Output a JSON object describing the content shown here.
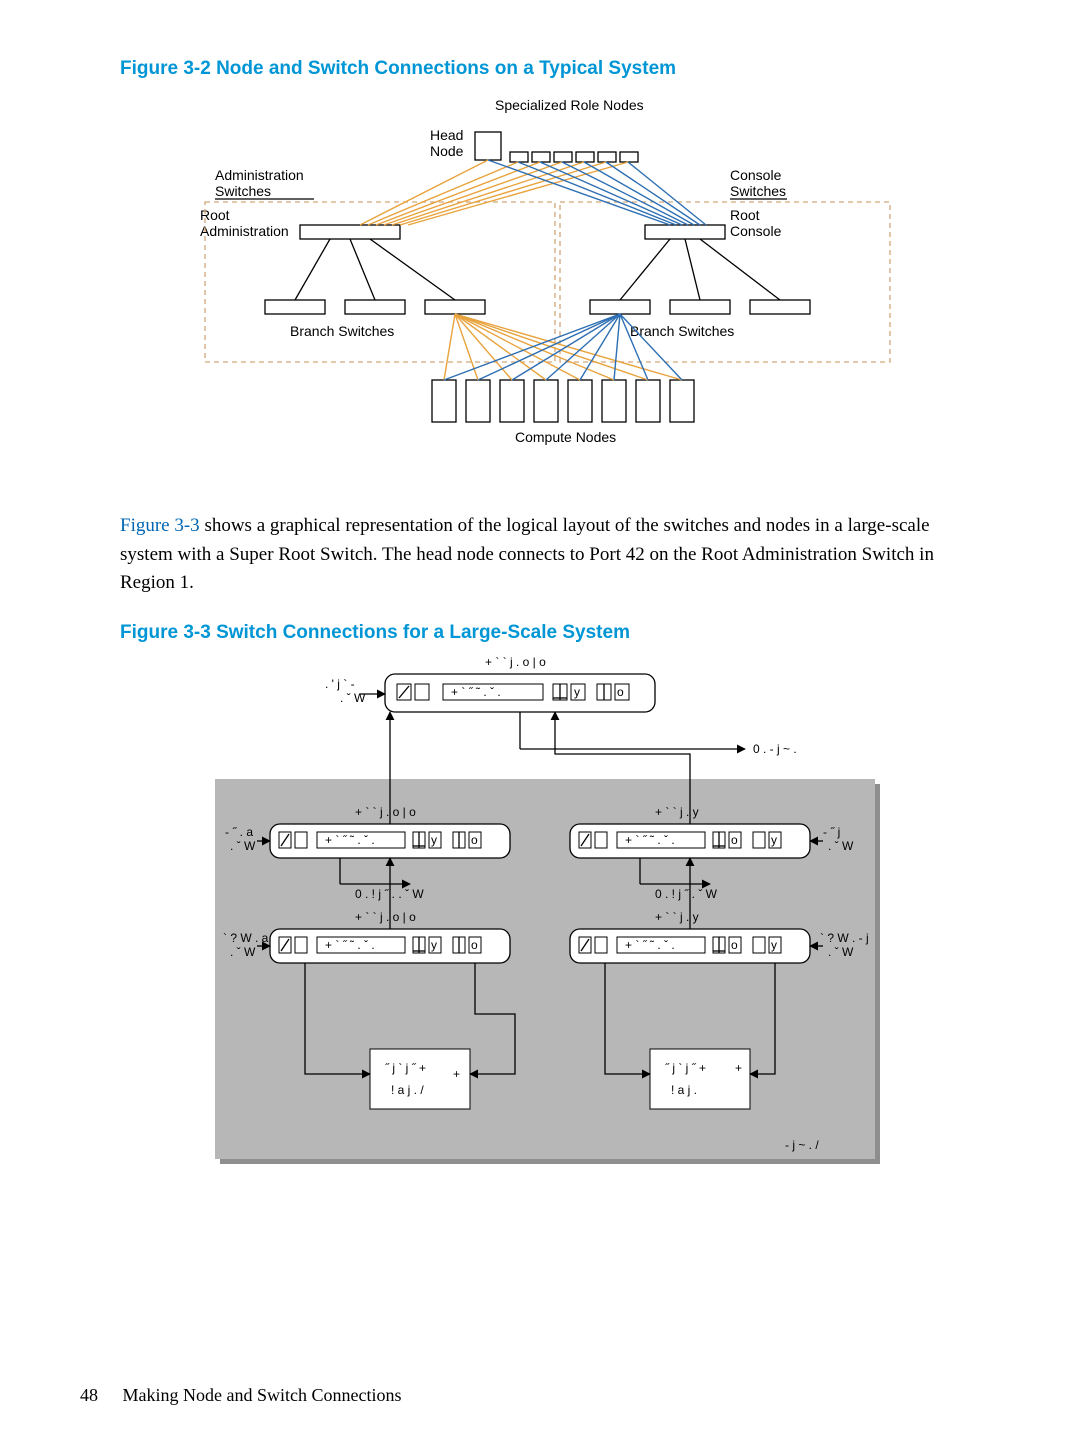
{
  "figure32": {
    "title": "Figure 3-2  Node and Switch Connections on a Typical System",
    "labels": {
      "specialized": "Specialized Role Nodes",
      "head1": "Head",
      "head2": "Node",
      "adminSwitches1": "Administration",
      "adminSwitches2": "Switches",
      "consoleSwitches1": "Console",
      "consoleSwitches2": "Switches",
      "rootAdmin1": "Root",
      "rootAdmin2": "Administration",
      "rootConsole1": "Root",
      "rootConsole2": "Console",
      "branchLeft": "Branch Switches",
      "branchRight": "Branch Switches",
      "compute": "Compute Nodes"
    }
  },
  "para": {
    "a": "Figure 3-3",
    "b": " shows a graphical representation of the logical layout of the switches and nodes in a large-scale system with a Super Root Switch. The head node connects to Port 42 on the Root Administration Switch in Region 1."
  },
  "figure33": {
    "title": "Figure 3-3 Switch Connections for a Large-Scale System"
  },
  "footer": {
    "page": "48",
    "section": "Making Node and Switch Connections"
  }
}
